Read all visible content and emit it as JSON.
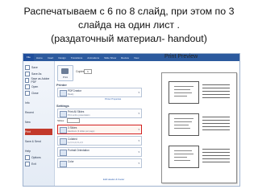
{
  "title_lines": [
    "Распечатываем с 6 по 8 слайд, при этом по 3",
    "слайда на один лист .",
    "(раздаточный материал- handout)"
  ],
  "preview_label": "Print Preview",
  "ribbon_tabs": [
    "File",
    "Home",
    "Insert",
    "Design",
    "Transitions",
    "Animations",
    "Slide Show",
    "Review",
    "View"
  ],
  "backstage": {
    "items": [
      "Save",
      "Save As",
      "Save as Adobe PDF",
      "Open",
      "Close",
      "Info",
      "Recent",
      "New",
      "Print",
      "Save & Send",
      "Help",
      "Options",
      "Exit"
    ],
    "selected": "Print"
  },
  "print_panel": {
    "print_button": "Print",
    "copies_label": "Copies:",
    "copies_value": "1",
    "printer_heading": "Printer",
    "printer_name": "PDFCreator",
    "printer_status": "Ready",
    "printer_properties": "Printer Properties",
    "settings_heading": "Settings",
    "slides_option": "Print All Slides",
    "slides_option_desc": "Print entire presentation",
    "slides_label": "Slides:",
    "layout_option": "3 Slides",
    "layout_option_desc": "Handouts (3 slides per page)",
    "collated": "Collated",
    "collated_desc": "1,2,3   1,2,3   1,2,3",
    "orientation": "Portrait Orientation",
    "color": "Color",
    "page_setup": "Edit Header & Footer"
  }
}
